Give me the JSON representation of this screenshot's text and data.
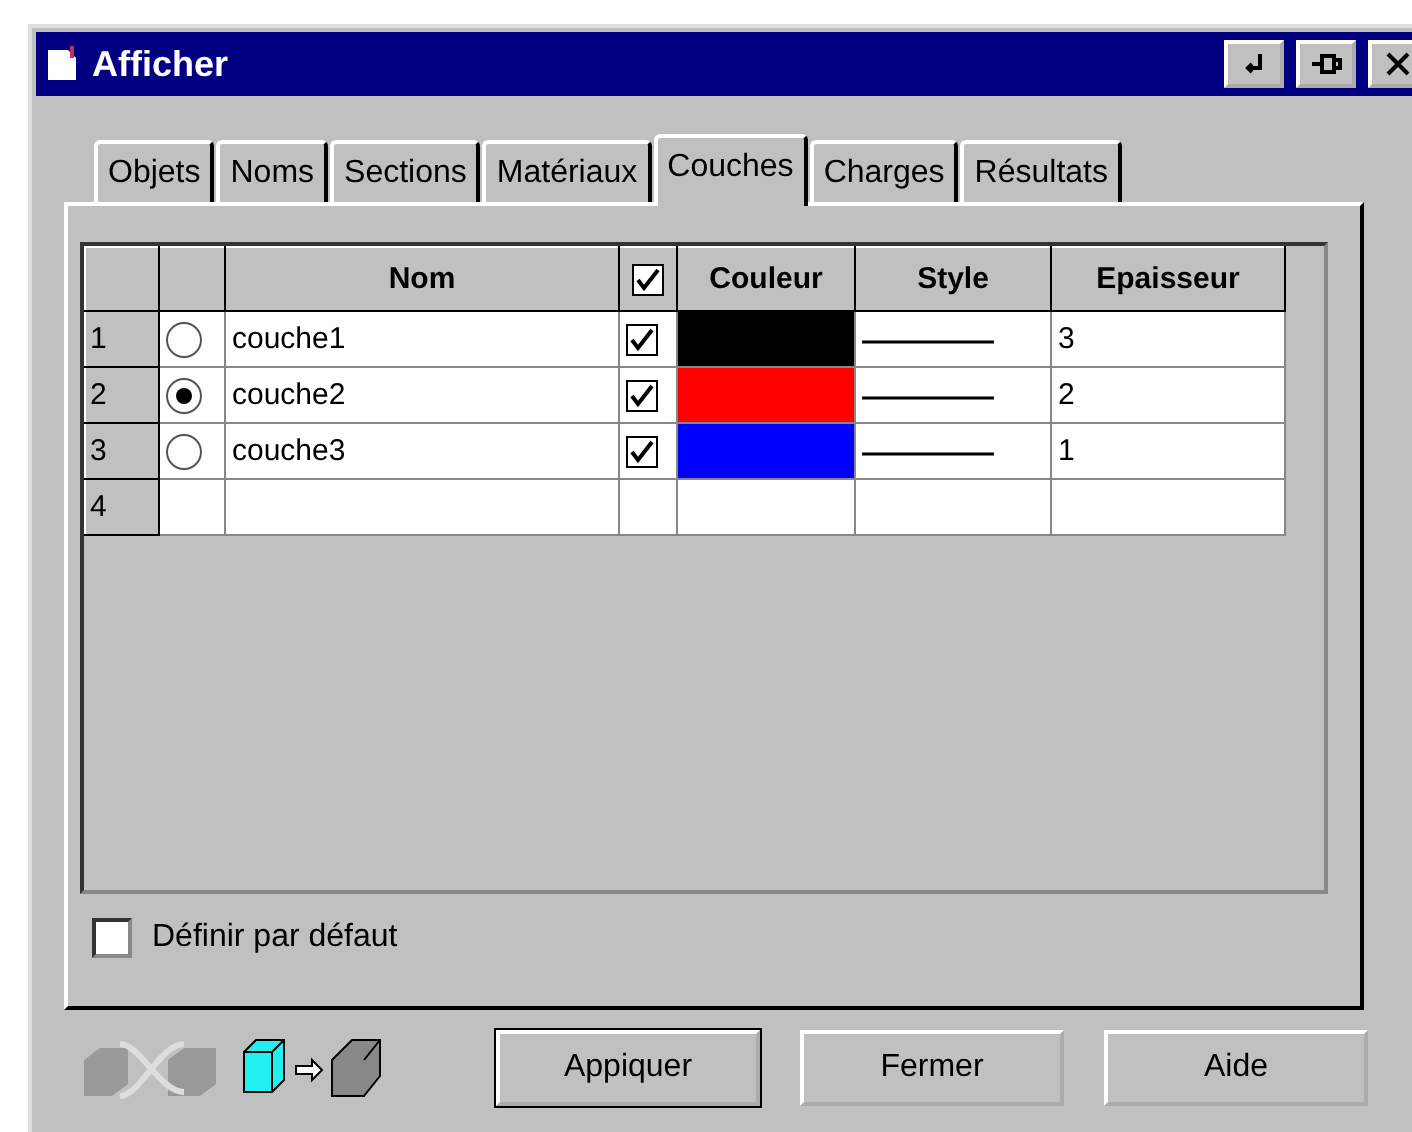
{
  "window": {
    "title": "Afficher"
  },
  "tabs": [
    {
      "label": "Objets",
      "selected": false
    },
    {
      "label": "Noms",
      "selected": false
    },
    {
      "label": "Sections",
      "selected": false
    },
    {
      "label": "Matériaux",
      "selected": false
    },
    {
      "label": "Couches",
      "selected": true
    },
    {
      "label": "Charges",
      "selected": false
    },
    {
      "label": "Résultats",
      "selected": false
    }
  ],
  "table": {
    "columns": [
      "Nom",
      "Couleur",
      "Style",
      "Epaisseur"
    ],
    "visible_all_checked": true,
    "rows": [
      {
        "number": "1",
        "selected": false,
        "name": "couche1",
        "visible": true,
        "color": "#000000",
        "thickness": "3"
      },
      {
        "number": "2",
        "selected": true,
        "name": "couche2",
        "visible": true,
        "color": "#ff0000",
        "thickness": "2"
      },
      {
        "number": "3",
        "selected": false,
        "name": "couche3",
        "visible": true,
        "color": "#0000ff",
        "thickness": "1"
      },
      {
        "number": "4"
      }
    ]
  },
  "default_checkbox": {
    "label": "Définir par défaut",
    "checked": false
  },
  "buttons": [
    {
      "label": "Appiquer",
      "default": true
    },
    {
      "label": "Fermer",
      "default": false
    },
    {
      "label": "Aide",
      "default": false
    }
  ]
}
